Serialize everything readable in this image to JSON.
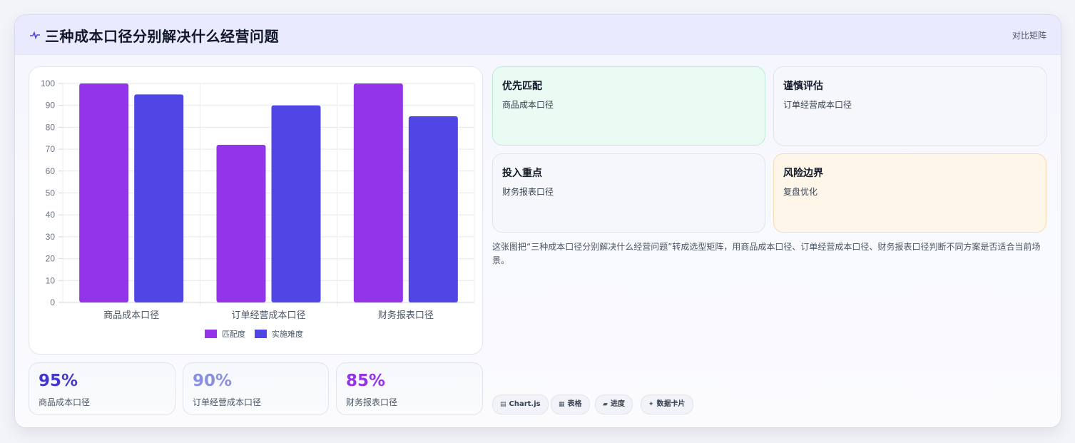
{
  "header": {
    "icon": "pulse-icon",
    "title": "三种成本口径分别解决什么经营问题",
    "tag": "对比矩阵"
  },
  "chart_data": {
    "type": "bar",
    "categories": [
      "商品成本口径",
      "订单经营成本口径",
      "财务报表口径"
    ],
    "series": [
      {
        "name": "匹配度",
        "values": [
          100,
          72,
          100
        ],
        "color": "#9333ea"
      },
      {
        "name": "实施难度",
        "values": [
          95,
          90,
          85
        ],
        "color": "#4f46e5"
      }
    ],
    "ylim": [
      0,
      100
    ],
    "yticks": [
      0,
      10,
      20,
      30,
      40,
      50,
      60,
      70,
      80,
      90,
      100
    ],
    "grid": true,
    "legend": "bottom"
  },
  "stats": [
    {
      "value": "95%",
      "label": "商品成本口径",
      "color": "#4338ca"
    },
    {
      "value": "90%",
      "label": "订单经营成本口径",
      "color": "#8b8fe0"
    },
    {
      "value": "85%",
      "label": "财务报表口径",
      "color": "#9333ea"
    }
  ],
  "tiles": [
    {
      "title": "优先匹配",
      "subtitle": "商品成本口径",
      "bg": "#e9fbf3",
      "border": "#b9ecd5"
    },
    {
      "title": "谨慎评估",
      "subtitle": "订单经营成本口径",
      "bg": "#f5f7fb",
      "border": "#dfe4ee"
    },
    {
      "title": "投入重点",
      "subtitle": "财务报表口径",
      "bg": "#f5f7fb",
      "border": "#dfe4ee"
    },
    {
      "title": "风险边界",
      "subtitle": "复盘优化",
      "bg": "#fef6e9",
      "border": "#f2dcb3"
    }
  ],
  "description": "这张图把“三种成本口径分别解决什么经营问题”转成选型矩阵，用商品成本口径、订单经营成本口径、财务报表口径判断不同方案是否适合当前场景。",
  "pills": [
    {
      "icon": "chart-icon",
      "glyph": "▤",
      "label": "Chart.js"
    },
    {
      "icon": "table-icon",
      "glyph": "▦",
      "label": "表格"
    },
    {
      "icon": "progress-icon",
      "glyph": "▰",
      "label": "进度"
    },
    {
      "icon": "sparkle-icon",
      "glyph": "✦",
      "label": "数据卡片"
    }
  ]
}
